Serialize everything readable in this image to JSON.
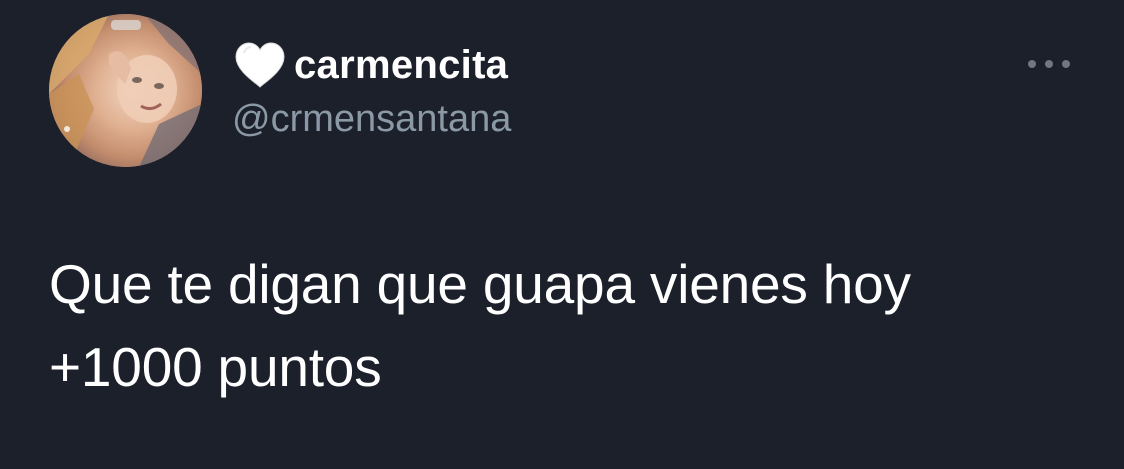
{
  "tweet": {
    "author": {
      "name_emoji": "white-heart-icon",
      "display_name": "carmencita",
      "handle": "@crmensantana",
      "avatar": "profile-photo"
    },
    "more_icon": "more-options-icon",
    "text_lines": [
      "Que te digan que guapa vienes hoy",
      "+1000 puntos"
    ]
  },
  "colors": {
    "background": "#1b202b",
    "text": "#ffffff",
    "handle": "#8b98a5",
    "more_dots": "#6e7782"
  }
}
